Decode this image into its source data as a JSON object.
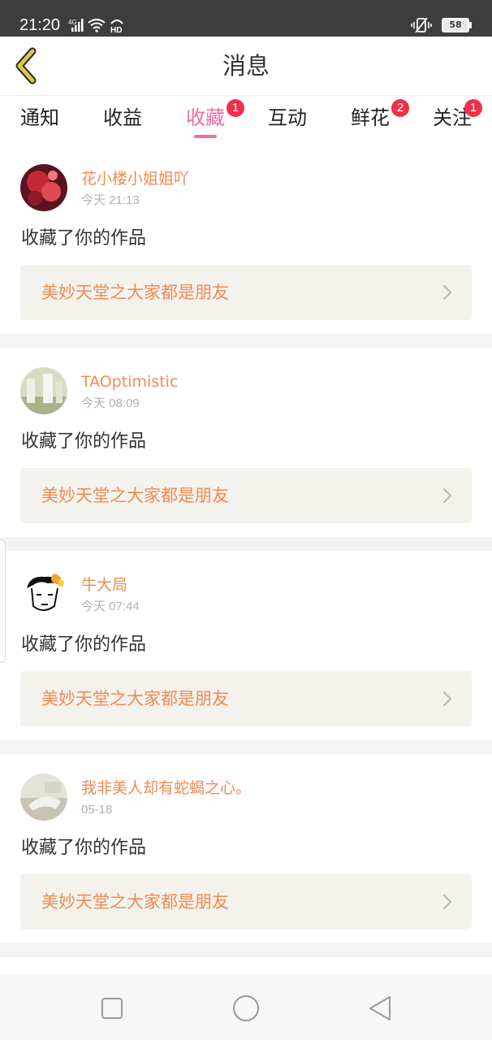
{
  "status_bar": {
    "time": "21:20",
    "network": "4G",
    "wifi": "HD",
    "battery": "58"
  },
  "header": {
    "title": "消息",
    "back_icon": "chevron-left-icon",
    "accent_color": "#e2c64a"
  },
  "tabs": [
    {
      "label": "通知",
      "badge": ""
    },
    {
      "label": "收益",
      "badge": ""
    },
    {
      "label": "收藏",
      "badge": "1",
      "active": true
    },
    {
      "label": "互动",
      "badge": ""
    },
    {
      "label": "鲜花",
      "badge": "2"
    },
    {
      "label": "关注",
      "badge": "1"
    }
  ],
  "messages": [
    {
      "user": "花小楼小姐姐吖",
      "time": "今天 21:13",
      "action": "收藏了你的作品",
      "work": "美妙天堂之大家都是朋友"
    },
    {
      "user": "TAOptimistic",
      "time": "今天 08:09",
      "action": "收藏了你的作品",
      "work": "美妙天堂之大家都是朋友"
    },
    {
      "user": "牛大局",
      "time": "今天 07:44",
      "action": "收藏了你的作品",
      "work": "美妙天堂之大家都是朋友"
    },
    {
      "user": "我非美人却有蛇蝎之心。",
      "time": "05-18",
      "action": "收藏了你的作品",
      "work": "美妙天堂之大家都是朋友"
    }
  ],
  "colors": {
    "active_tab": "#ef6ca6",
    "username": "#f08a52",
    "badge": "#f0304a",
    "card_bg": "#f3f2ec"
  },
  "nav_icons": [
    "square-recents-icon",
    "circle-home-icon",
    "triangle-back-icon"
  ]
}
